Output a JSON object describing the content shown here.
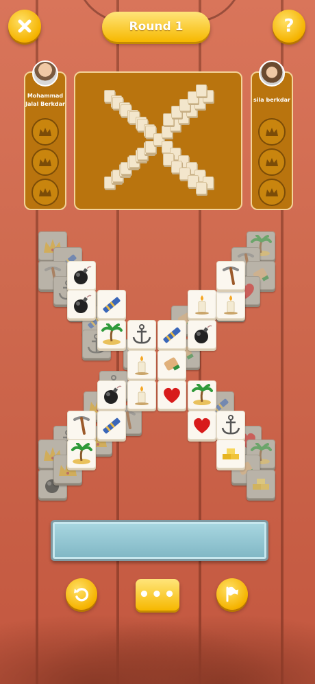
{
  "header": {
    "round_label": "Round 1",
    "close_icon": "close-icon",
    "help_icon": "question-icon"
  },
  "players": {
    "left": {
      "name_line1": "Mohammad",
      "name_line2": "Jalal Berkdar",
      "crowns": 3
    },
    "right": {
      "name": "sila berkdar",
      "crowns": 3
    }
  },
  "board": {
    "tile_icons": [
      "bomb",
      "telescope",
      "palm-island",
      "anchor",
      "candle",
      "flag-scroll",
      "heart",
      "pickaxe",
      "gold-bars",
      "crown"
    ]
  },
  "tray": {
    "slots_filled": 0
  },
  "footer": {
    "undo_icon": "undo-icon",
    "menu_label": "•••",
    "hint_icon": "flag-icon"
  },
  "colors": {
    "accent": "#f6b800",
    "panel": "#b9740e",
    "background": "#cf6a4f"
  }
}
